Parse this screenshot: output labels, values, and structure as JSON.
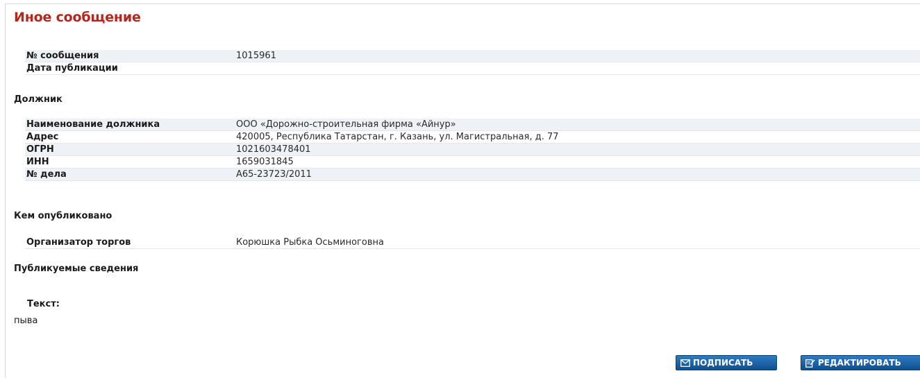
{
  "page": {
    "title": "Иное сообщение"
  },
  "message": {
    "rows": [
      {
        "label": "№ сообщения",
        "value": "1015961"
      },
      {
        "label": "Дата публикации",
        "value": ""
      }
    ]
  },
  "debtor": {
    "heading": "Должник",
    "rows": [
      {
        "label": "Наименование должника",
        "value": "ООО «Дорожно-строительная фирма «Айнур»"
      },
      {
        "label": "Адрес",
        "value": "420005, Республика Татарстан, г. Казань, ул. Магистральная, д. 77"
      },
      {
        "label": "ОГРН",
        "value": "1021603478401"
      },
      {
        "label": "ИНН",
        "value": "1659031845"
      },
      {
        "label": "№ дела",
        "value": "А65-23723/2011"
      }
    ]
  },
  "publisher": {
    "heading": "Кем опубликовано",
    "rows": [
      {
        "label": "Организатор торгов",
        "value": "Корюшка Рыбка Осьминоговна"
      }
    ]
  },
  "published_info": {
    "heading": "Публикуемые сведения",
    "text_label": "Текст:",
    "text_value": "пыва"
  },
  "actions": {
    "sign_label": "ПОДПИСАТЬ",
    "sign_icon": "envelope-icon",
    "edit_label": "РЕДАКТИРОВАТЬ",
    "edit_icon": "edit-document-icon"
  },
  "colors": {
    "title": "#b5271d",
    "button": "#0f5396",
    "row_shade": "#eef1f5"
  }
}
